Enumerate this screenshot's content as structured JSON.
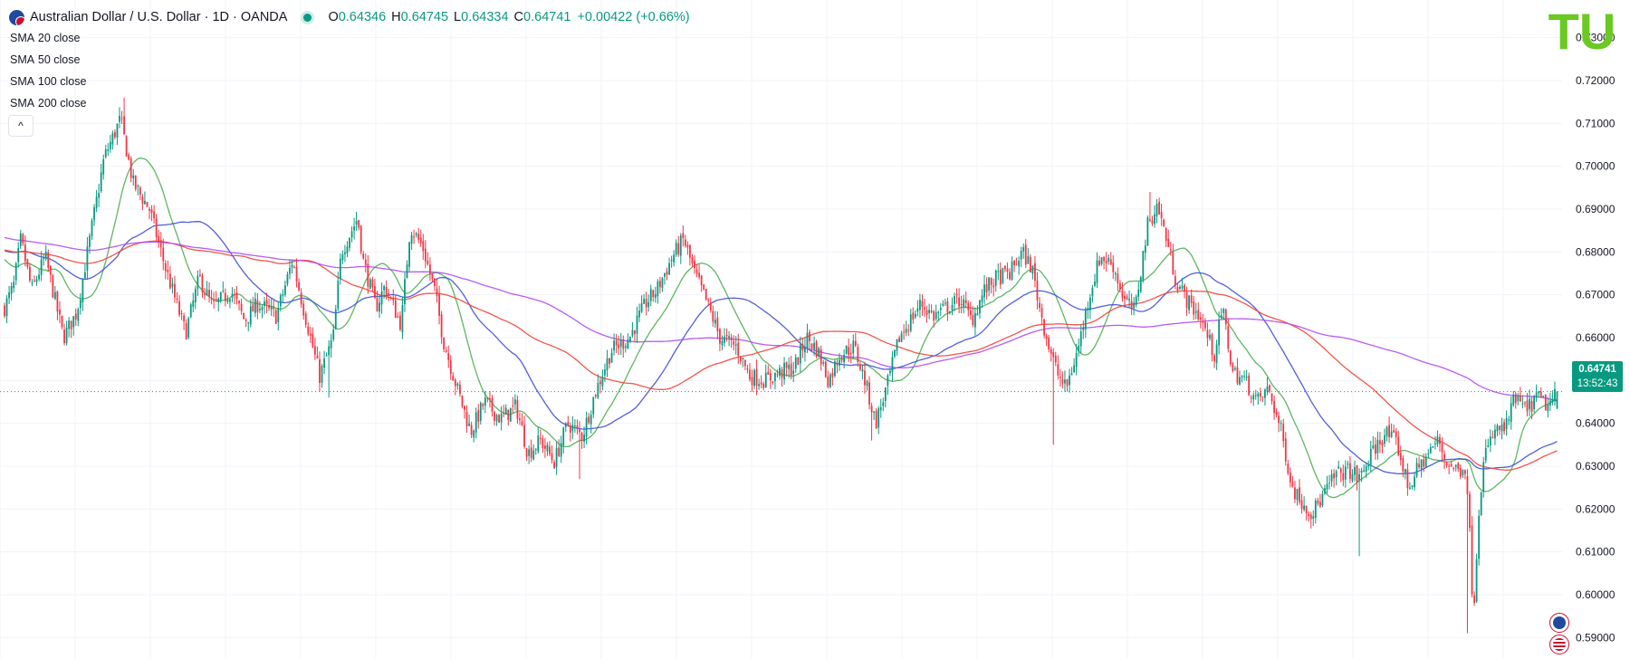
{
  "header": {
    "title": "Australian Dollar / U.S. Dollar · 1D · OANDA",
    "open_label": "O",
    "open": "0.64346",
    "high_label": "H",
    "high": "0.64745",
    "low_label": "L",
    "low": "0.64334",
    "close_label": "C",
    "close": "0.64741",
    "change": "+0.00422 (+0.66%)"
  },
  "legend": [
    {
      "label": "SMA",
      "value": "20 close"
    },
    {
      "label": "SMA",
      "value": "50 close"
    },
    {
      "label": "SMA",
      "value": "100 close"
    },
    {
      "label": "SMA",
      "value": "200 close"
    }
  ],
  "collapse_symbol": "^",
  "logo_text": "TU",
  "price_tag": {
    "price": "0.64741",
    "countdown": "13:52:43"
  },
  "colors": {
    "up": "#089981",
    "down": "#f23645",
    "sma20": "#4caf50",
    "sma50": "#3e4fd6",
    "sma100": "#f44336",
    "sma200": "#b04af2",
    "grid": "#f0f3fa",
    "logo": "#6ac922"
  },
  "chart_data": {
    "type": "candlestick",
    "symbol": "AUDUSD",
    "timeframe": "1D",
    "ylim": [
      0.585,
      0.735
    ],
    "yticks": [
      "0.59000",
      "0.60000",
      "0.61000",
      "0.62000",
      "0.63000",
      "0.64000",
      "0.65000",
      "0.66000",
      "0.67000",
      "0.68000",
      "0.69000",
      "0.70000",
      "0.71000",
      "0.72000",
      "0.73000"
    ],
    "current_price": 0.64741,
    "anchors": [
      [
        0,
        0.667
      ],
      [
        10,
        0.672
      ],
      [
        18,
        0.683
      ],
      [
        30,
        0.671
      ],
      [
        45,
        0.679
      ],
      [
        65,
        0.66
      ],
      [
        80,
        0.666
      ],
      [
        95,
        0.684
      ],
      [
        110,
        0.702
      ],
      [
        128,
        0.711
      ],
      [
        142,
        0.696
      ],
      [
        160,
        0.69
      ],
      [
        178,
        0.676
      ],
      [
        200,
        0.661
      ],
      [
        215,
        0.674
      ],
      [
        230,
        0.667
      ],
      [
        250,
        0.671
      ],
      [
        265,
        0.664
      ],
      [
        280,
        0.668
      ],
      [
        300,
        0.665
      ],
      [
        318,
        0.678
      ],
      [
        330,
        0.667
      ],
      [
        348,
        0.651
      ],
      [
        363,
        0.66
      ],
      [
        372,
        0.68
      ],
      [
        390,
        0.688
      ],
      [
        396,
        0.678
      ],
      [
        410,
        0.667
      ],
      [
        420,
        0.672
      ],
      [
        438,
        0.663
      ],
      [
        448,
        0.686
      ],
      [
        462,
        0.681
      ],
      [
        475,
        0.671
      ],
      [
        485,
        0.659
      ],
      [
        500,
        0.648
      ],
      [
        515,
        0.638
      ],
      [
        530,
        0.645
      ],
      [
        548,
        0.641
      ],
      [
        565,
        0.644
      ],
      [
        578,
        0.633
      ],
      [
        592,
        0.636
      ],
      [
        607,
        0.631
      ],
      [
        622,
        0.64
      ],
      [
        638,
        0.637
      ],
      [
        652,
        0.647
      ],
      [
        670,
        0.657
      ],
      [
        690,
        0.66
      ],
      [
        708,
        0.668
      ],
      [
        720,
        0.671
      ],
      [
        738,
        0.679
      ],
      [
        750,
        0.683
      ],
      [
        762,
        0.675
      ],
      [
        776,
        0.668
      ],
      [
        790,
        0.66
      ],
      [
        808,
        0.658
      ],
      [
        823,
        0.651
      ],
      [
        840,
        0.65
      ],
      [
        858,
        0.652
      ],
      [
        872,
        0.653
      ],
      [
        886,
        0.66
      ],
      [
        898,
        0.657
      ],
      [
        910,
        0.65
      ],
      [
        922,
        0.656
      ],
      [
        938,
        0.658
      ],
      [
        950,
        0.65
      ],
      [
        962,
        0.64
      ],
      [
        975,
        0.649
      ],
      [
        988,
        0.66
      ],
      [
        1000,
        0.664
      ],
      [
        1012,
        0.668
      ],
      [
        1026,
        0.665
      ],
      [
        1040,
        0.667
      ],
      [
        1056,
        0.669
      ],
      [
        1068,
        0.664
      ],
      [
        1082,
        0.671
      ],
      [
        1096,
        0.674
      ],
      [
        1110,
        0.675
      ],
      [
        1124,
        0.68
      ],
      [
        1135,
        0.676
      ],
      [
        1143,
        0.667
      ],
      [
        1152,
        0.659
      ],
      [
        1162,
        0.652
      ],
      [
        1172,
        0.648
      ],
      [
        1185,
        0.657
      ],
      [
        1198,
        0.67
      ],
      [
        1210,
        0.679
      ],
      [
        1224,
        0.677
      ],
      [
        1236,
        0.669
      ],
      [
        1248,
        0.666
      ],
      [
        1262,
        0.686
      ],
      [
        1273,
        0.691
      ],
      [
        1282,
        0.684
      ],
      [
        1294,
        0.673
      ],
      [
        1308,
        0.668
      ],
      [
        1320,
        0.665
      ],
      [
        1336,
        0.656
      ],
      [
        1345,
        0.667
      ],
      [
        1356,
        0.652
      ],
      [
        1370,
        0.65
      ],
      [
        1383,
        0.645
      ],
      [
        1396,
        0.648
      ],
      [
        1410,
        0.638
      ],
      [
        1422,
        0.625
      ],
      [
        1432,
        0.622
      ],
      [
        1444,
        0.619
      ],
      [
        1456,
        0.623
      ],
      [
        1470,
        0.628
      ],
      [
        1485,
        0.629
      ],
      [
        1496,
        0.627
      ],
      [
        1510,
        0.633
      ],
      [
        1525,
        0.638
      ],
      [
        1538,
        0.635
      ],
      [
        1550,
        0.625
      ],
      [
        1560,
        0.629
      ],
      [
        1572,
        0.633
      ],
      [
        1583,
        0.636
      ],
      [
        1592,
        0.631
      ],
      [
        1605,
        0.629
      ],
      [
        1614,
        0.63
      ],
      [
        1618,
        0.614
      ],
      [
        1622,
        0.595
      ],
      [
        1628,
        0.62
      ],
      [
        1634,
        0.632
      ],
      [
        1645,
        0.638
      ],
      [
        1658,
        0.639
      ],
      [
        1668,
        0.646
      ],
      [
        1680,
        0.643
      ],
      [
        1692,
        0.646
      ],
      [
        1705,
        0.644
      ],
      [
        1716,
        0.6474
      ]
    ],
    "spikes": [
      {
        "x": 1163,
        "low": 0.635
      },
      {
        "x": 1500,
        "low": 0.609
      },
      {
        "x": 1620,
        "low": 0.591
      },
      {
        "x": 136,
        "high": 0.716
      },
      {
        "x": 1269,
        "high": 0.694
      },
      {
        "x": 962,
        "low": 0.636
      },
      {
        "x": 640,
        "low": 0.627
      },
      {
        "x": 363,
        "low": 0.646
      }
    ],
    "series": [
      {
        "name": "SMA 20 close",
        "period": 20
      },
      {
        "name": "SMA 50 close",
        "period": 50
      },
      {
        "name": "SMA 100 close",
        "period": 100
      },
      {
        "name": "SMA 200 close",
        "period": 200
      }
    ]
  }
}
